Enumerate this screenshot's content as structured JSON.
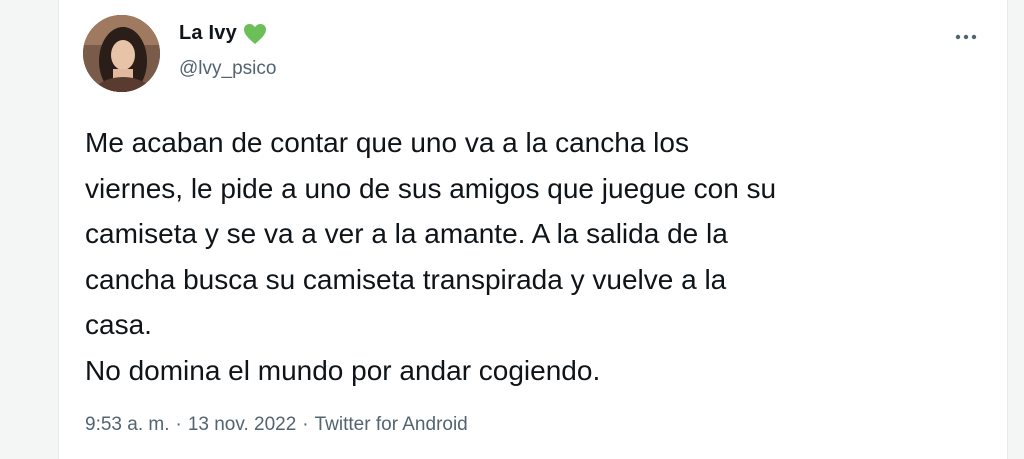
{
  "author": {
    "display_name": "La Ivy",
    "handle": "@lvy_psico",
    "badge": "green-heart-icon",
    "badge_color": "#6bbf59"
  },
  "tweet": {
    "text": "Me acaban de contar que uno va a la cancha los\nviernes, le pide a uno de sus amigos que juegue con su\ncamiseta y se va a ver a la amante. A la salida de la\ncancha busca su camiseta transpirada y vuelve a la\ncasa.\nNo domina el mundo por andar cogiendo.",
    "time": "9:53 a. m.",
    "date": "13 nov. 2022",
    "source": "Twitter for Android",
    "separator": "·"
  },
  "actions": {
    "more_icon": "more-dots-icon"
  }
}
